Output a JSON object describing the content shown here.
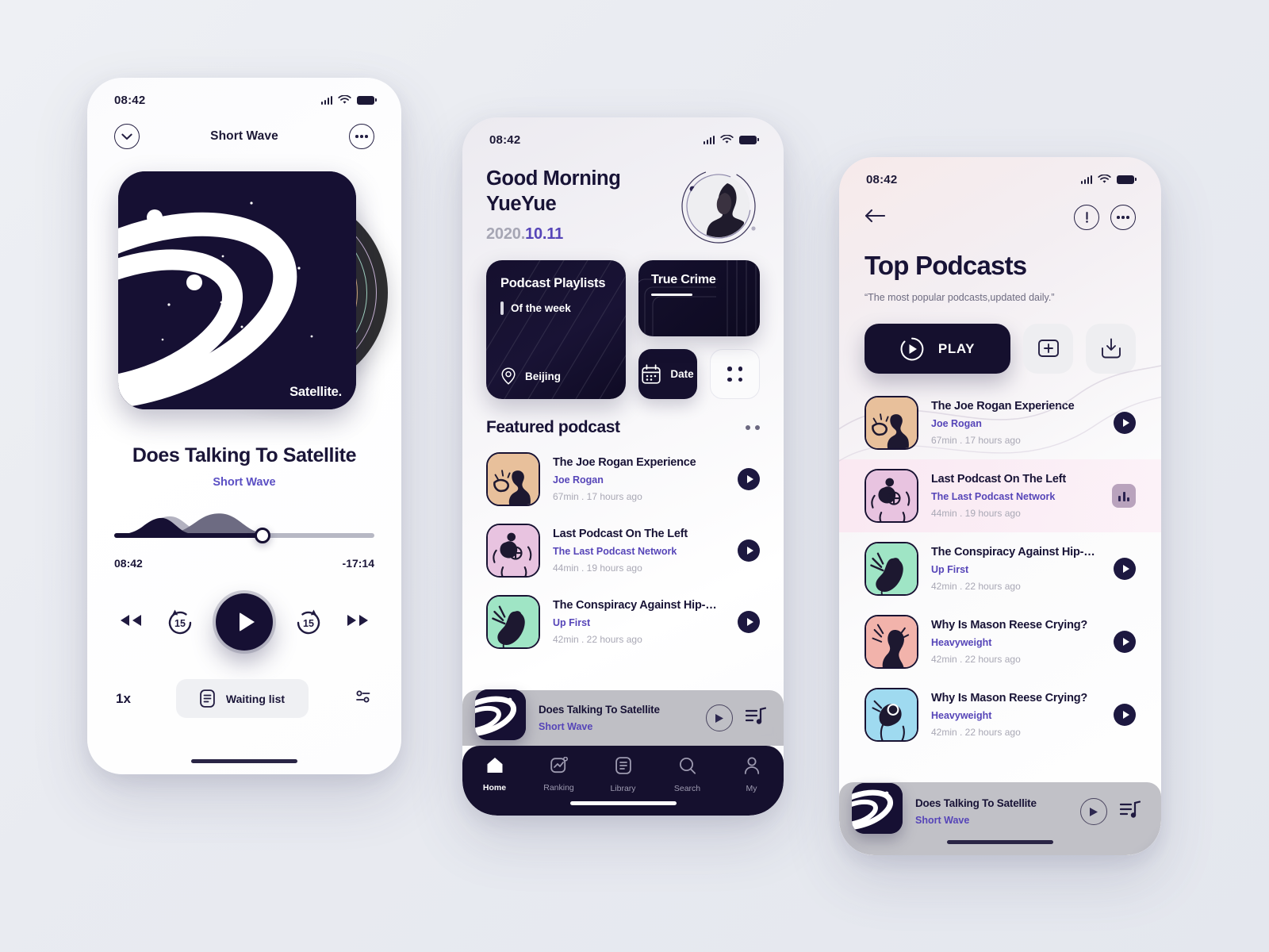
{
  "status": {
    "time": "08:42"
  },
  "player": {
    "header_title": "Short Wave",
    "collapse_icon": "chevron-down-icon",
    "more_icon": "more-options-icon",
    "artwork_label": "Satellite.",
    "track_title": "Does Talking To Satellite",
    "track_subtitle": "Short Wave",
    "elapsed": "08:42",
    "remaining": "-17:14",
    "progress_percent": 57,
    "rewind_icon": "rewind-icon",
    "back15_label": "15",
    "play_icon": "play-icon",
    "forward15_label": "15",
    "fastforward_icon": "fast-forward-icon",
    "speed_label": "1x",
    "waiting_list_label": "Waiting list",
    "waiting_list_icon": "list-icon",
    "settings_icon": "sliders-icon"
  },
  "home": {
    "greeting_line1": "Good Morning",
    "greeting_line2": "YueYue",
    "date_year": "2020.",
    "date_monthday": "10.11",
    "avatar": "user-avatar",
    "playlist_card": {
      "title": "Podcast Playlists",
      "subtitle": "Of the week",
      "location": "Beijing",
      "location_icon": "location-pin-icon"
    },
    "true_crime_card": {
      "title": "True Crime"
    },
    "date_button": {
      "label": "Date",
      "icon": "calendar-icon"
    },
    "grid_button": {
      "icon": "grid-dots-icon"
    },
    "featured": {
      "section_title": "Featured podcast",
      "more_icon": "more-dots-icon",
      "items": [
        {
          "title": "The Joe Rogan Experience",
          "author": "Joe Rogan",
          "meta": "67min .  17 hours ago",
          "color": "#e8c09b"
        },
        {
          "title": "Last Podcast On The Left",
          "author": "The Last Podcast Network",
          "meta": "44min .  19 hours ago",
          "color": "#e8c3e0"
        },
        {
          "title": "The Conspiracy Against Hip-Hop",
          "author": "Up First",
          "meta": "42min .  22 hours ago",
          "color": "#9fe5c5"
        }
      ]
    },
    "mini_player": {
      "title": "Does Talking To Satellite",
      "subtitle": "Short Wave",
      "play_icon": "play-circle-icon",
      "queue_icon": "playlist-music-icon"
    },
    "tabs": [
      {
        "label": "Home",
        "icon": "home-icon",
        "active": true
      },
      {
        "label": "Ranking",
        "icon": "chart-icon",
        "active": false
      },
      {
        "label": "Library",
        "icon": "book-icon",
        "active": false
      },
      {
        "label": "Search",
        "icon": "search-icon",
        "active": false
      },
      {
        "label": "My",
        "icon": "user-icon",
        "active": false
      }
    ]
  },
  "top": {
    "back_icon": "arrow-left-icon",
    "info_icon": "info-circle-icon",
    "more_icon": "more-options-icon",
    "title": "Top Podcasts",
    "subtitle": "“The most popular podcasts,updated daily.”",
    "play_button": {
      "label": "PLAY",
      "icon": "play-circle-icon"
    },
    "add_button": {
      "icon": "add-square-icon"
    },
    "download_button": {
      "icon": "download-icon"
    },
    "items": [
      {
        "title": "The Joe Rogan Experience",
        "author": "Joe Rogan",
        "meta": "67min .  17 hours ago",
        "color": "#e8c09b",
        "state": "play"
      },
      {
        "title": "Last Podcast On The Left",
        "author": "The Last Podcast Network",
        "meta": "44min .  19 hours ago",
        "color": "#e8c3e0",
        "state": "playing"
      },
      {
        "title": "The Conspiracy Against Hip-Hop",
        "author": "Up First",
        "meta": "42min .  22 hours ago",
        "color": "#9fe5c5",
        "state": "play"
      },
      {
        "title": "Why Is Mason Reese Crying?",
        "author": "Heavyweight",
        "meta": "42min .  22 hours ago",
        "color": "#f2b3ab",
        "state": "play"
      },
      {
        "title": "Why Is Mason Reese Crying?",
        "author": "Heavyweight",
        "meta": "42min .  22 hours ago",
        "color": "#9fdaf0",
        "state": "play"
      }
    ],
    "mini_player": {
      "title": "Does Talking To Satellite",
      "subtitle": "Short Wave",
      "play_icon": "play-circle-icon",
      "queue_icon": "playlist-music-icon"
    }
  },
  "colors": {
    "ink": "#181336",
    "accent": "#5645b8",
    "muted": "#a9a8b5",
    "background": "#eceef3"
  }
}
